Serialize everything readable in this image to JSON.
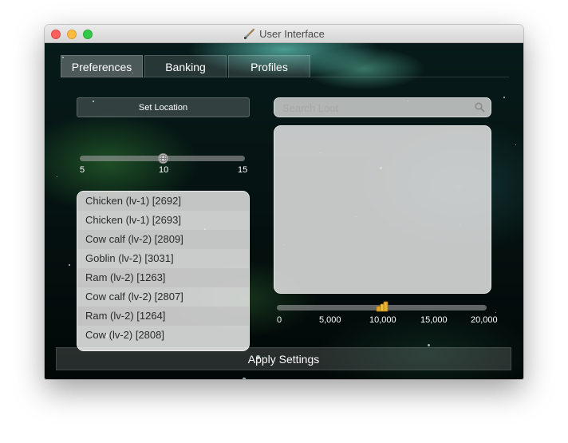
{
  "window": {
    "title": "User Interface",
    "title_icon": "paintbrush-icon"
  },
  "tabs": [
    {
      "label": "Preferences",
      "selected": true
    },
    {
      "label": "Banking",
      "selected": false
    },
    {
      "label": "Profiles",
      "selected": false
    }
  ],
  "location": {
    "button_label": "Set Location",
    "slider": {
      "min": 5,
      "max": 15,
      "value": 10,
      "thumb_icon": "globe-icon"
    },
    "tick_labels": [
      "5",
      "10",
      "15"
    ]
  },
  "npc_list": {
    "items": [
      "Chicken (lv-1) [2692]",
      "Chicken (lv-1) [2693]",
      "Cow calf (lv-2) [2809]",
      "Goblin (lv-2) [3031]",
      "Ram (lv-2) [1263]",
      "Cow calf (lv-2) [2807]",
      "Ram (lv-2) [1264]",
      "Cow (lv-2) [2808]"
    ]
  },
  "loot": {
    "search_placeholder": "Search Loot",
    "search_value": "",
    "items": [],
    "slider": {
      "min": 0,
      "max": 20000,
      "value": 10000,
      "thumb_icon": "coins-icon"
    },
    "tick_labels": [
      "0",
      "5,000",
      "10,000",
      "15,000",
      "20,000"
    ]
  },
  "apply_label": "Apply Settings",
  "colors": {
    "background_space": "#071b1a",
    "nebula": "#6ee1d2",
    "close": "#fc605c",
    "minimize": "#fdbc40",
    "maximize": "#34c84a"
  }
}
